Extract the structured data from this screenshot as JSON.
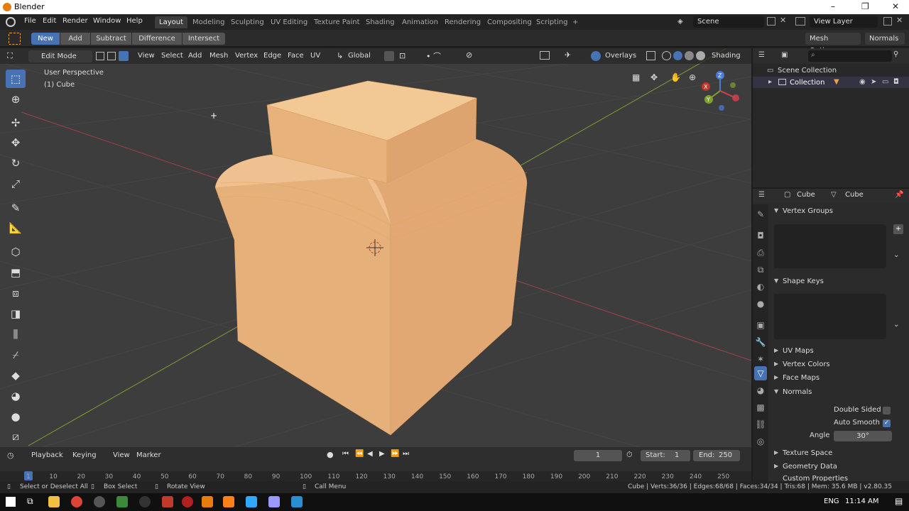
{
  "titlebar": {
    "title": "Blender",
    "minimize": "–",
    "maximize": "❐",
    "close": "✕"
  },
  "menus": [
    "File",
    "Edit",
    "Render",
    "Window",
    "Help"
  ],
  "workspaces": [
    "Layout",
    "Modeling",
    "Sculpting",
    "UV Editing",
    "Texture Paint",
    "Shading",
    "Animation",
    "Rendering",
    "Compositing",
    "Scripting",
    "+"
  ],
  "scene": "Scene",
  "view_layer": "View Layer",
  "tool_header": {
    "ops": [
      "New",
      "Add",
      "Subtract",
      "Difference",
      "Intersect"
    ],
    "mesh_options": "Mesh Options",
    "normals": "Normals"
  },
  "viewport_header": {
    "mode": "Edit Mode",
    "menus": [
      "View",
      "Select",
      "Add",
      "Mesh",
      "Vertex",
      "Edge",
      "Face",
      "UV"
    ],
    "orientation": "Global",
    "overlays": "Overlays",
    "shading": "Shading"
  },
  "viewport": {
    "perspective": "User Perspective",
    "object": "(1) Cube"
  },
  "gizmo": {
    "x": "X",
    "y": "Y",
    "z": "Z"
  },
  "outliner": {
    "scene_collection": "Scene Collection",
    "collection": "Collection"
  },
  "properties": {
    "object": "Cube",
    "mesh": "Cube",
    "panels": {
      "vertex_groups": "Vertex Groups",
      "shape_keys": "Shape Keys",
      "uv_maps": "UV Maps",
      "vertex_colors": "Vertex Colors",
      "face_maps": "Face Maps",
      "normals": "Normals",
      "texture_space": "Texture Space",
      "geometry_data": "Geometry Data",
      "custom_properties": "Custom Properties"
    },
    "double_sided": "Double Sided",
    "auto_smooth": "Auto Smooth",
    "angle_label": "Angle",
    "angle_value": "30°"
  },
  "timeline": {
    "menus": [
      "Playback",
      "Keying",
      "View",
      "Marker"
    ],
    "current_frame": "1",
    "start_label": "Start:",
    "start": "1",
    "end_label": "End:",
    "end": "250",
    "ticks": [
      "1",
      "10",
      "20",
      "30",
      "40",
      "50",
      "60",
      "70",
      "80",
      "90",
      "100",
      "110",
      "120",
      "130",
      "140",
      "150",
      "160",
      "170",
      "180",
      "190",
      "200",
      "210",
      "220",
      "230",
      "240",
      "250"
    ]
  },
  "status": {
    "select": "Select or Deselect All",
    "box_select": "Box Select",
    "rotate": "Rotate View",
    "call_menu": "Call Menu",
    "stats": "Cube | Verts:36/36 | Edges:68/68 | Faces:34/34 | Tris:68 | Mem: 35.6 MB | v2.80.35"
  },
  "taskbar": {
    "lang": "ENG",
    "time": "11:14 AM"
  },
  "colors": {
    "accent": "#4772b3",
    "mesh": "#e8b27c",
    "grid_x": "#a04050",
    "grid_y": "#7ea030"
  }
}
